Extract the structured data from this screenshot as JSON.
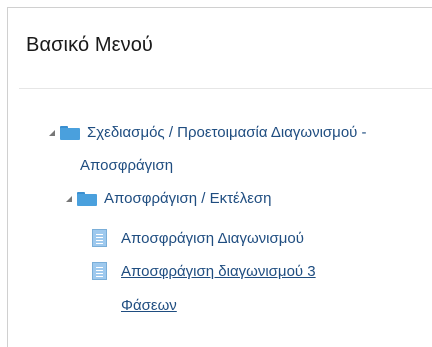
{
  "panel": {
    "title": "Βασικό Μενού"
  },
  "tree": {
    "node1": {
      "label_line1": "Σχεδιασμός / Προετοιμασία Διαγωνισμού -",
      "label_line2": "Αποσφράγιση",
      "icon": "folder-icon",
      "expanded": true
    },
    "node2": {
      "label": "Αποσφράγιση / Εκτέλεση",
      "icon": "folder-icon",
      "expanded": true
    },
    "leaf1": {
      "label": "Αποσφράγιση Διαγωνισμού",
      "icon": "document-icon"
    },
    "leaf2": {
      "label_line1": "Αποσφράγιση διαγωνισμού 3",
      "label_line2": "Φάσεων",
      "icon": "document-icon",
      "hovered": true
    }
  },
  "colors": {
    "link": "#1f4d80",
    "folder": "#4aa0dd",
    "document": "#9ec9ee",
    "toggle": "#777777"
  }
}
